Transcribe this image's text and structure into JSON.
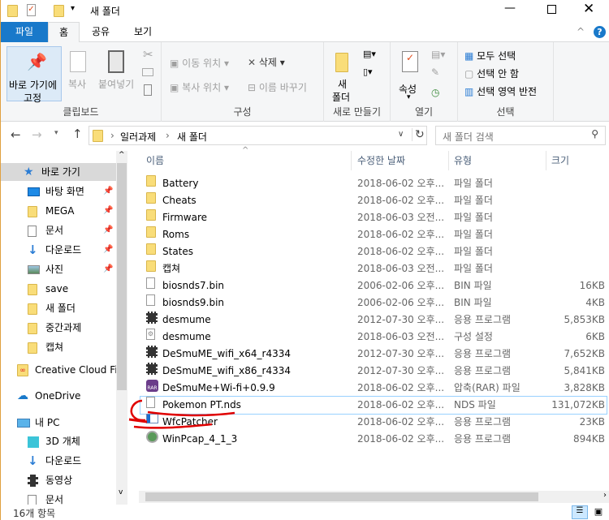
{
  "window": {
    "title": "새 폴더"
  },
  "tabs": [
    {
      "label": "파일",
      "active": false
    },
    {
      "label": "홈",
      "active": true
    },
    {
      "label": "공유"
    },
    {
      "label": "보기"
    }
  ],
  "ribbon": {
    "clipboard": {
      "label": "클립보드",
      "pin": "바로 가기에",
      "pin2": "고정",
      "copy": "복사",
      "paste": "붙여넣기"
    },
    "organize": {
      "label": "구성",
      "move_to": "이동 위치",
      "copy_to": "복사 위치",
      "delete": "삭제",
      "rename": "이름 바꾸기"
    },
    "new": {
      "label": "새로 만들기",
      "new_folder": "새",
      "new_folder2": "폴더"
    },
    "open": {
      "label": "열기",
      "properties": "속성"
    },
    "select": {
      "label": "선택",
      "select_all": "모두 선택",
      "select_none": "선택 안 함",
      "invert": "선택 영역 반전"
    }
  },
  "address": {
    "crumbs": [
      "일러과제",
      "새 폴더"
    ],
    "search_placeholder": "새 폴더 검색"
  },
  "columns": {
    "name": "이름",
    "date": "수정한 날짜",
    "type": "유형",
    "size": "크기"
  },
  "nav": [
    {
      "label": "바로 가기",
      "icon": "star-icon",
      "selected": true
    },
    {
      "label": "바탕 화면",
      "icon": "desktop-icon",
      "pinned": true
    },
    {
      "label": "MEGA",
      "icon": "folder-icon",
      "pinned": true
    },
    {
      "label": "문서",
      "icon": "document-icon",
      "pinned": true
    },
    {
      "label": "다운로드",
      "icon": "download-icon",
      "pinned": true
    },
    {
      "label": "사진",
      "icon": "picture-icon",
      "pinned": true
    },
    {
      "label": "save",
      "icon": "folder-icon"
    },
    {
      "label": "새 폴더",
      "icon": "folder-icon"
    },
    {
      "label": "중간과제",
      "icon": "folder-icon"
    },
    {
      "label": "캡쳐",
      "icon": "folder-icon"
    },
    {
      "label": "Creative Cloud Fil",
      "icon": "creative-cloud-icon"
    },
    {
      "label": "OneDrive",
      "icon": "onedrive-icon"
    },
    {
      "label": "내 PC",
      "icon": "pc-icon"
    },
    {
      "label": "3D 개체",
      "icon": "cube-icon"
    },
    {
      "label": "다운로드",
      "icon": "download-icon"
    },
    {
      "label": "동영상",
      "icon": "video-icon"
    },
    {
      "label": "문서",
      "icon": "document-icon"
    }
  ],
  "files": [
    {
      "name": "Battery",
      "date": "2018-06-02 오후...",
      "type": "파일 폴더",
      "size": "",
      "icon": "folder-icon"
    },
    {
      "name": "Cheats",
      "date": "2018-06-02 오후...",
      "type": "파일 폴더",
      "size": "",
      "icon": "folder-icon"
    },
    {
      "name": "Firmware",
      "date": "2018-06-03 오전...",
      "type": "파일 폴더",
      "size": "",
      "icon": "folder-icon"
    },
    {
      "name": "Roms",
      "date": "2018-06-02 오후...",
      "type": "파일 폴더",
      "size": "",
      "icon": "folder-icon"
    },
    {
      "name": "States",
      "date": "2018-06-02 오후...",
      "type": "파일 폴더",
      "size": "",
      "icon": "folder-icon"
    },
    {
      "name": "캡쳐",
      "date": "2018-06-03 오전...",
      "type": "파일 폴더",
      "size": "",
      "icon": "folder-icon"
    },
    {
      "name": "biosnds7.bin",
      "date": "2006-02-06 오후...",
      "type": "BIN 파일",
      "size": "16KB",
      "icon": "file-icon"
    },
    {
      "name": "biosnds9.bin",
      "date": "2006-02-06 오후...",
      "type": "BIN 파일",
      "size": "4KB",
      "icon": "file-icon"
    },
    {
      "name": "desmume",
      "date": "2012-07-30 오후...",
      "type": "응용 프로그램",
      "size": "5,853KB",
      "icon": "desmume-icon"
    },
    {
      "name": "desmume",
      "date": "2018-06-03 오전...",
      "type": "구성 설정",
      "size": "6KB",
      "icon": "settings-file-icon"
    },
    {
      "name": "DeSmuME_wifi_x64_r4334",
      "date": "2012-07-30 오후...",
      "type": "응용 프로그램",
      "size": "7,652KB",
      "icon": "desmume-icon"
    },
    {
      "name": "DeSmuME_wifi_x86_r4334",
      "date": "2012-07-30 오후...",
      "type": "응용 프로그램",
      "size": "5,841KB",
      "icon": "desmume-icon"
    },
    {
      "name": "DeSmuMe+Wi-fi+0.9.9",
      "date": "2018-06-02 오후...",
      "type": "압축(RAR) 파일",
      "size": "3,828KB",
      "icon": "rar-icon"
    },
    {
      "name": "Pokemon PT.nds",
      "date": "2018-06-02 오후...",
      "type": "NDS 파일",
      "size": "131,072KB",
      "icon": "file-icon",
      "focused": true
    },
    {
      "name": "WfcPatcher",
      "date": "2018-06-02 오후...",
      "type": "응용 프로그램",
      "size": "23KB",
      "icon": "app-icon"
    },
    {
      "name": "WinPcap_4_1_3",
      "date": "2018-06-02 오후...",
      "type": "응용 프로그램",
      "size": "894KB",
      "icon": "winpcap-icon"
    }
  ],
  "status": {
    "count": "16개 항목"
  },
  "colors": {
    "accent": "#1979ca",
    "selection": "#cce8ff",
    "annotation": "#e00000"
  }
}
